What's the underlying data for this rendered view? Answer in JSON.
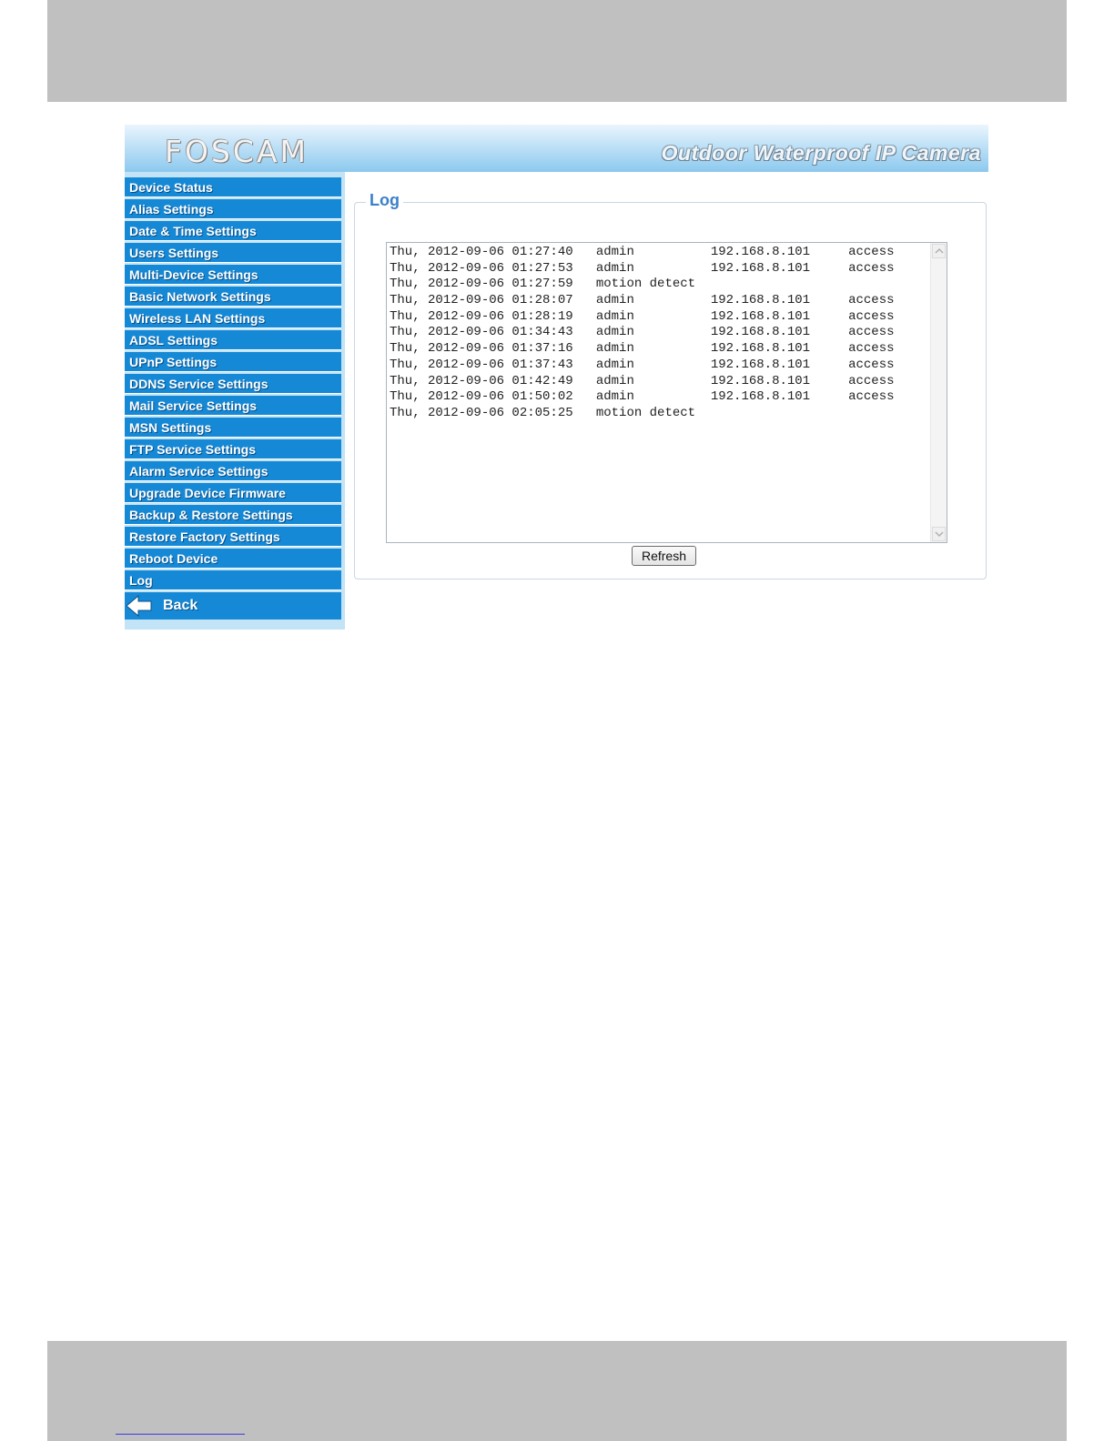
{
  "banner": {
    "logo": "FOSCAM",
    "product_title": "Outdoor Waterproof IP Camera"
  },
  "sidebar": {
    "items": [
      {
        "label": "Device Status"
      },
      {
        "label": "Alias Settings"
      },
      {
        "label": "Date & Time Settings"
      },
      {
        "label": "Users Settings"
      },
      {
        "label": "Multi-Device Settings"
      },
      {
        "label": "Basic Network Settings"
      },
      {
        "label": "Wireless LAN Settings"
      },
      {
        "label": "ADSL Settings"
      },
      {
        "label": "UPnP Settings"
      },
      {
        "label": "DDNS Service Settings"
      },
      {
        "label": "Mail Service Settings"
      },
      {
        "label": "MSN Settings"
      },
      {
        "label": "FTP Service Settings"
      },
      {
        "label": "Alarm Service Settings"
      },
      {
        "label": "Upgrade Device Firmware"
      },
      {
        "label": "Backup & Restore Settings"
      },
      {
        "label": "Restore Factory Settings"
      },
      {
        "label": "Reboot Device"
      },
      {
        "label": "Log"
      }
    ],
    "back_label": "Back"
  },
  "log_panel": {
    "title": "Log",
    "entries": [
      "Thu, 2012-09-06 01:27:40   admin          192.168.8.101     access",
      "Thu, 2012-09-06 01:27:53   admin          192.168.8.101     access",
      "Thu, 2012-09-06 01:27:59   motion detect",
      "Thu, 2012-09-06 01:28:07   admin          192.168.8.101     access",
      "Thu, 2012-09-06 01:28:19   admin          192.168.8.101     access",
      "Thu, 2012-09-06 01:34:43   admin          192.168.8.101     access",
      "Thu, 2012-09-06 01:37:16   admin          192.168.8.101     access",
      "Thu, 2012-09-06 01:37:43   admin          192.168.8.101     access",
      "Thu, 2012-09-06 01:42:49   admin          192.168.8.101     access",
      "Thu, 2012-09-06 01:50:02   admin          192.168.8.101     access",
      "Thu, 2012-09-06 02:05:25   motion detect"
    ],
    "refresh_label": "Refresh"
  },
  "icons": {
    "back": "arrow-left-icon",
    "scroll_up": "chevron-up-icon",
    "scroll_down": "chevron-down-icon"
  },
  "colors": {
    "menu_blue": "#1589d6",
    "sidebar_bg": "#c3e4f7",
    "title_blue": "#3b80cc",
    "band_gray": "#c0c0c0"
  }
}
